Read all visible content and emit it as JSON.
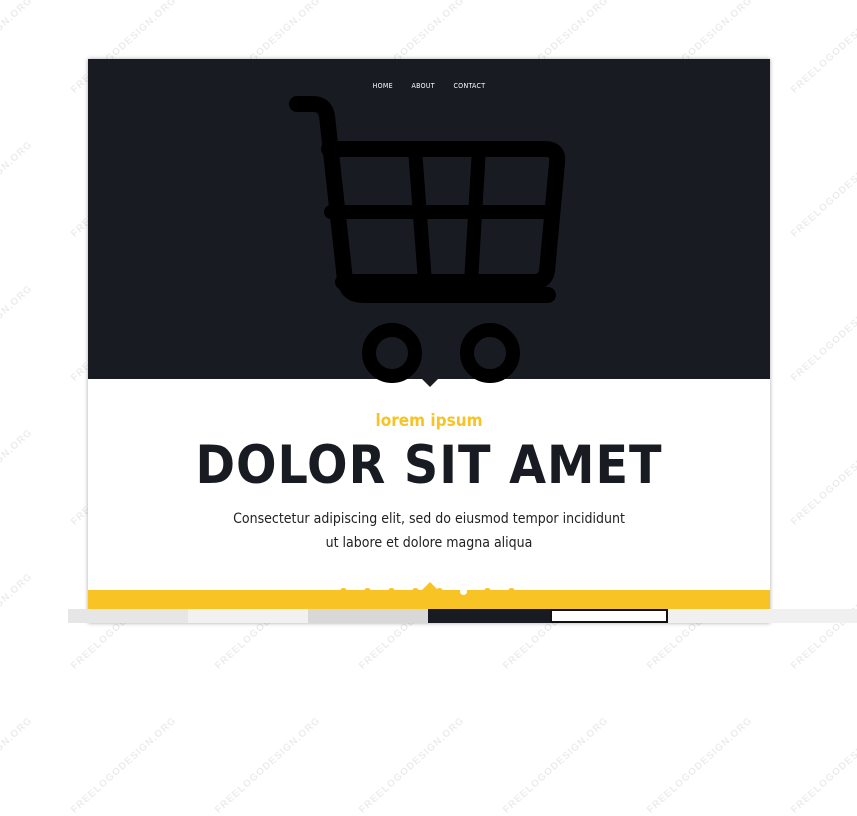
{
  "nav": {
    "items": [
      "HOME",
      "ABOUT",
      "CONTACT"
    ]
  },
  "hero": {
    "icon": "shopping-cart-icon",
    "background": "#181c22"
  },
  "content": {
    "eyebrow": "lorem ipsum",
    "title": "DOLOR SIT AMET",
    "description": "Consectetur adipiscing elit, sed do eiusmod tempor incididunt ut labore et dolore magna aliqua"
  },
  "colors": {
    "accent": "#f7c325",
    "dark": "#181c22",
    "text": "#222222"
  },
  "carousel": {
    "slide_count": 8,
    "active_index": 5
  },
  "watermark": "FREELOGODESIGN.ORG"
}
